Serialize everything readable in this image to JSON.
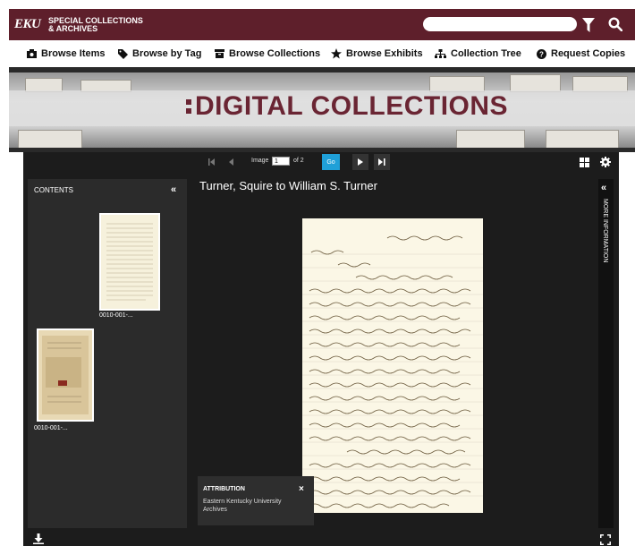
{
  "header": {
    "logo": "EKU",
    "logo_sub_line1": "SPECIAL COLLECTIONS",
    "logo_sub_line2": "& ARCHIVES",
    "search_placeholder": "",
    "icons": [
      "filter-icon",
      "search-icon"
    ],
    "bar_color": "#5e1f2b"
  },
  "nav": {
    "items": [
      {
        "label": "Browse Items",
        "icon": "camera-icon"
      },
      {
        "label": "Browse by Tag",
        "icon": "tag-icon"
      },
      {
        "label": "Browse Collections",
        "icon": "archive-box-icon"
      },
      {
        "label": "Browse Exhibits",
        "icon": "star-icon"
      },
      {
        "label": "Collection Tree",
        "icon": "sitemap-icon"
      },
      {
        "label": "Request Copies",
        "icon": "question-circle-icon"
      }
    ]
  },
  "banner": {
    "title": "DIGITAL COLLECTIONS",
    "title_color": "#6a2533"
  },
  "viewer": {
    "toolbar": {
      "image_label": "Image",
      "current_page": "1",
      "of_label": "of 2",
      "go_label": "Go",
      "go_color": "#1fa0d8"
    },
    "contents": {
      "title": "CONTENTS",
      "thumbnails": [
        {
          "label": "0010-001-..."
        },
        {
          "label": "0010-001-..."
        }
      ]
    },
    "document_title": "Turner, Squire to William S. Turner",
    "attribution": {
      "title": "ATTRIBUTION",
      "close": "×",
      "text": "Eastern Kentucky University Archives"
    },
    "more_info_label": "MORE INFORMATION"
  }
}
